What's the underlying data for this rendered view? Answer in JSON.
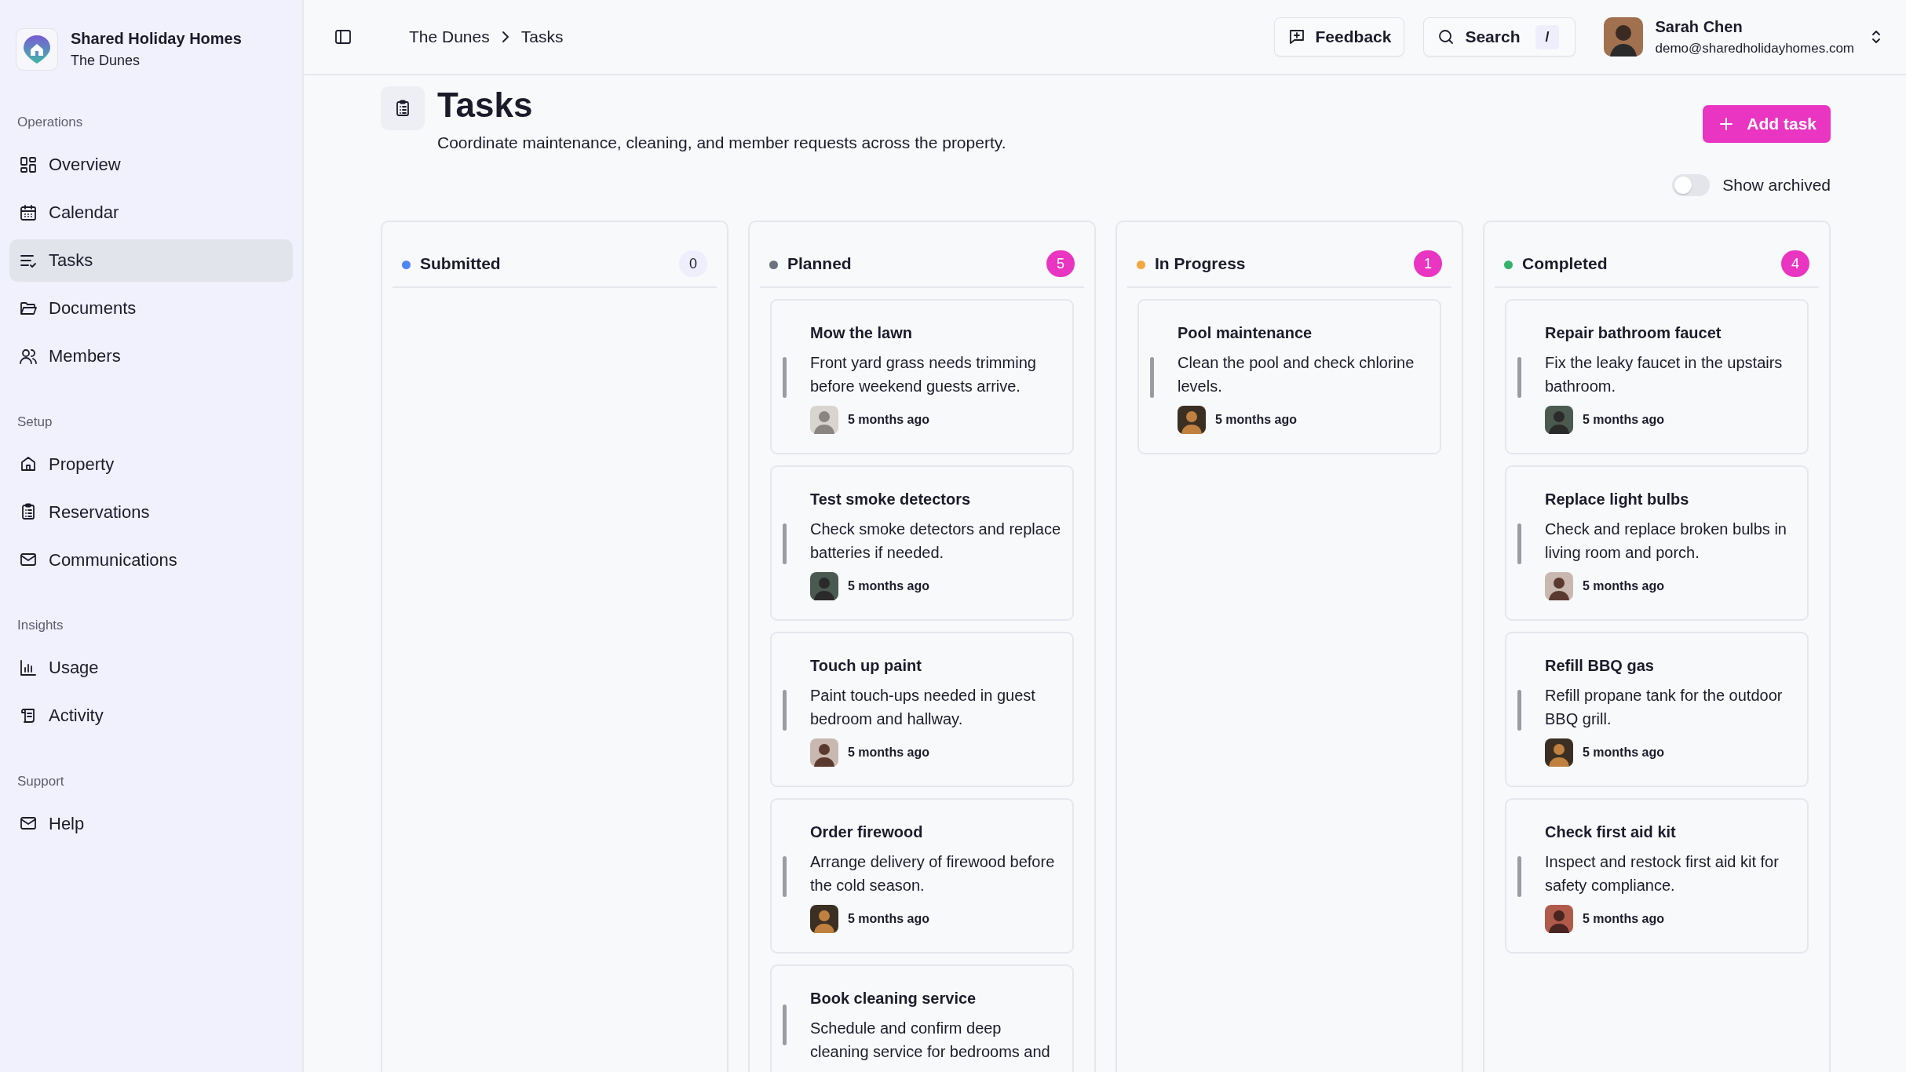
{
  "app": {
    "name": "Shared Holiday Homes",
    "property": "The Dunes"
  },
  "sidebar": {
    "sections": [
      {
        "title": "Operations",
        "items": [
          {
            "label": "Overview",
            "selected": false
          },
          {
            "label": "Calendar",
            "selected": false
          },
          {
            "label": "Tasks",
            "selected": true
          },
          {
            "label": "Documents",
            "selected": false
          },
          {
            "label": "Members",
            "selected": false
          }
        ]
      },
      {
        "title": "Setup",
        "items": [
          {
            "label": "Property",
            "selected": false
          },
          {
            "label": "Reservations",
            "selected": false
          },
          {
            "label": "Communications",
            "selected": false
          }
        ]
      },
      {
        "title": "Insights",
        "items": [
          {
            "label": "Usage",
            "selected": false
          },
          {
            "label": "Activity",
            "selected": false
          }
        ]
      },
      {
        "title": "Support",
        "items": [
          {
            "label": "Help",
            "selected": false
          }
        ]
      }
    ]
  },
  "header": {
    "breadcrumb": [
      "The Dunes",
      "Tasks"
    ],
    "feedback": "Feedback",
    "search": {
      "label": "Search",
      "shortcut": "/"
    },
    "user": {
      "name": "Sarah Chen",
      "email": "demo@sharedholidayhomes.com"
    }
  },
  "page": {
    "title": "Tasks",
    "subtitle": "Coordinate maintenance, cleaning, and member requests across the property.",
    "add_button": "Add task",
    "show_archived": {
      "label": "Show archived",
      "on": false
    }
  },
  "columns": [
    {
      "title": "Submitted",
      "color": "#4f86f7",
      "count": "0"
    },
    {
      "title": "Planned",
      "color": "#6b7280",
      "count": "5",
      "tasks": [
        {
          "title": "Mow the lawn",
          "description": "Front yard grass needs trimming before weekend guests arrive.",
          "time": "5 months ago"
        },
        {
          "title": "Test smoke detectors",
          "description": "Check smoke detectors and replace batteries if needed.",
          "time": "5 months ago"
        },
        {
          "title": "Touch up paint",
          "description": "Paint touch-ups needed in guest bedroom and hallway.",
          "time": "5 months ago"
        },
        {
          "title": "Order firewood",
          "description": "Arrange delivery of firewood before the cold season.",
          "time": "5 months ago"
        },
        {
          "title": "Book cleaning service",
          "description": "Schedule and confirm deep cleaning service for bedrooms and"
        }
      ]
    },
    {
      "title": "In Progress",
      "color": "#f5a742",
      "count": "1",
      "tasks": [
        {
          "title": "Pool maintenance",
          "description": "Clean the pool and check chlorine levels.",
          "time": "5 months ago"
        }
      ]
    },
    {
      "title": "Completed",
      "color": "#34b36b",
      "count": "4",
      "tasks": [
        {
          "title": "Repair bathroom faucet",
          "description": "Fix the leaky faucet in the upstairs bathroom.",
          "time": "5 months ago"
        },
        {
          "title": "Replace light bulbs",
          "description": "Check and replace broken bulbs in living room and porch.",
          "time": "5 months ago"
        },
        {
          "title": "Refill BBQ gas",
          "description": "Refill propane tank for the outdoor BBQ grill.",
          "time": "5 months ago"
        },
        {
          "title": "Check first aid kit",
          "description": "Inspect and restock first aid kit for safety compliance.",
          "time": "5 months ago"
        }
      ]
    }
  ]
}
